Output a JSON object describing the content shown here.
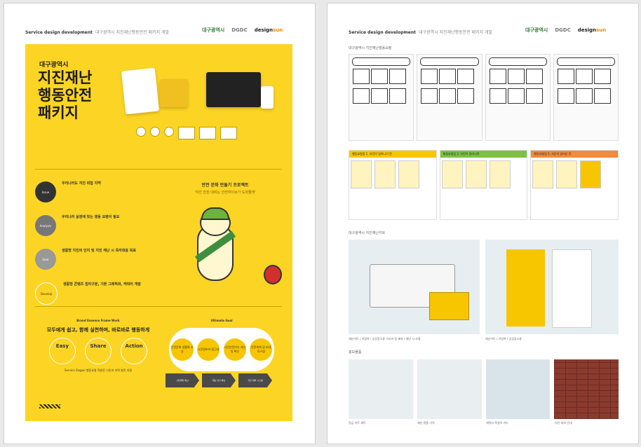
{
  "header": {
    "title": "Service design development",
    "subtitle": "대구광역시 지진재난행동안전 패키지 개발",
    "logos": {
      "daegu": "대구광역시",
      "dgdc": "DGDC",
      "designsun_prefix": "design",
      "designsun_suffix": "sun"
    }
  },
  "poster": {
    "org": "대구광역시",
    "title_lines": [
      "지진재난",
      "행동안전",
      "패키지"
    ],
    "steps": [
      {
        "node": "Issue",
        "heading": "우리나라도 지진 위험 지역"
      },
      {
        "node": "Analysis",
        "heading": "우리나라 실정에 맞는 행동 요령이 필요"
      },
      {
        "node": "Goal",
        "heading": "생활형 지진의 인지 및 지진 재난 시 즉각대응 목표"
      },
      {
        "node": "Develop",
        "heading": "생활형 콘텐츠 접리구분, 기본 그래픽화, 캐릭터 개발"
      }
    ],
    "campaign": {
      "title": "안전 문화 만들기 프로젝트",
      "subtitle": "'지진 안전 대비는 안전하이브가 도와줄게'"
    },
    "framework": {
      "label": "Brand Essence Frame Work",
      "headline": "모두에게 쉽고, 함께 실천하며, 바로바로 행동하게",
      "rings": [
        "Easy",
        "Share",
        "Action"
      ],
      "blurb": "Service Slogan 행동요령 적용된 시민과 지역 발전 과정"
    },
    "goal": {
      "label": "Ultimate Goal",
      "items": [
        "안전문화 생활화 조성",
        "시민정보의 접근성",
        "시민안전의식 개선 및 확산",
        "안전체계 및 비대 모스템"
      ],
      "arrows": [
        "시민대피 확산",
        "재난 인식 확인",
        "지진 대피 시스템"
      ]
    }
  },
  "page2": {
    "sec1": "대구광역시 지진재난행동요령",
    "band_labels": [
      "행동요령집 1. 지진이 일어나기 전",
      "행동요령집 2. 지진이 일어나면",
      "행동요령집 3. 지진이 일어난 후"
    ],
    "sec2": "대구광역시 지진재난키트",
    "cap_printer": "재난키트 / 키링북 / 공공장소용 스티커 등 배포 / 재난 시 사용",
    "cap_cards": "재난키트 / 키링북 / 공공장소용",
    "sec3": "홍보물품",
    "prod_caps": [
      "응급 키트 세트",
      "재난 용품 거치",
      "캐릭터 목걸이 카드",
      "지진 대피 안내"
    ]
  },
  "colors": {
    "poster_bg": "#fcd424",
    "accent_green": "#3d8f3d",
    "dark": "#333333"
  }
}
